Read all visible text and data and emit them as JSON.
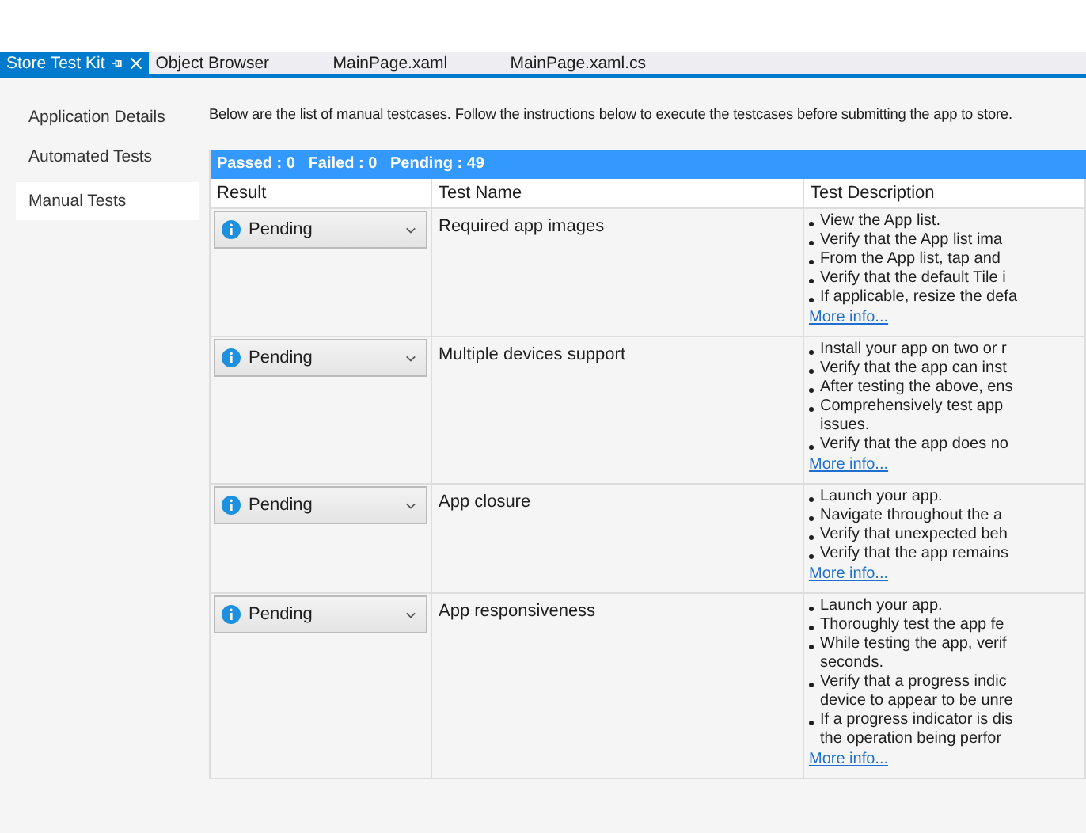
{
  "tabs": [
    {
      "label": "Store Test Kit",
      "selected": true
    },
    {
      "label": "Object Browser",
      "selected": false
    },
    {
      "label": "MainPage.xaml",
      "selected": false
    },
    {
      "label": "MainPage.xaml.cs",
      "selected": false
    }
  ],
  "sidebar": {
    "items": [
      {
        "label": "Application Details",
        "selected": false
      },
      {
        "label": "Automated Tests",
        "selected": false
      },
      {
        "label": "Manual Tests",
        "selected": true
      }
    ]
  },
  "intro": "Below are the list of manual testcases. Follow the instructions below to execute the testcases before submitting the app to store.",
  "summary": "Passed : 0   Failed : 0   Pending : 49",
  "table": {
    "columns": [
      "Result",
      "Test Name",
      "Test Description"
    ],
    "rows": [
      {
        "result": {
          "label": "Pending",
          "kind": "pending"
        },
        "name": "Required app images",
        "steps": [
          [
            "View the App list."
          ],
          [
            "Verify that the App list ima"
          ],
          [
            "From the App list, tap and"
          ],
          [
            "Verify that the default Tile i"
          ],
          [
            "If applicable, resize the defa"
          ]
        ],
        "link": "More info..."
      },
      {
        "result": {
          "label": "Pending",
          "kind": "pending"
        },
        "name": "Multiple devices support",
        "steps": [
          [
            "Install your app on two or r"
          ],
          [
            "Verify that the app can inst"
          ],
          [
            "After testing the above, ens"
          ],
          [
            "Comprehensively test app",
            "issues."
          ],
          [
            "Verify that the app does no"
          ]
        ],
        "link": "More info..."
      },
      {
        "result": {
          "label": "Pending",
          "kind": "pending"
        },
        "name": "App closure",
        "steps": [
          [
            "Launch your app."
          ],
          [
            "Navigate throughout the a"
          ],
          [
            "Verify that unexpected beh"
          ],
          [
            "Verify that the app remains"
          ]
        ],
        "link": "More info..."
      },
      {
        "result": {
          "label": "Pending",
          "kind": "pending"
        },
        "name": "App responsiveness",
        "steps": [
          [
            "Launch your app."
          ],
          [
            "Thoroughly test the app fe"
          ],
          [
            "While testing the app, verif",
            "seconds."
          ],
          [
            "Verify that a progress indic",
            "device to appear to be unre"
          ],
          [
            "If a progress indicator is dis",
            "the operation being perfor"
          ]
        ],
        "link": "More info..."
      }
    ]
  }
}
